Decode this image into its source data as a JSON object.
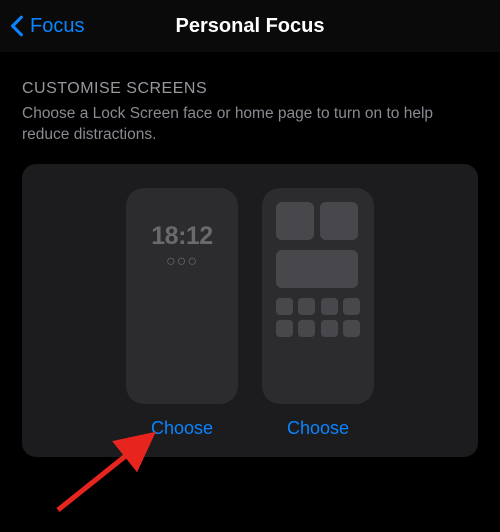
{
  "nav": {
    "back_label": "Focus",
    "title": "Personal Focus"
  },
  "section": {
    "header": "CUSTOMISE SCREENS",
    "description": "Choose a Lock Screen face or home page to turn on to help reduce distractions."
  },
  "screens": {
    "lock": {
      "time": "18:12",
      "dots": "○○○",
      "choose_label": "Choose"
    },
    "home": {
      "choose_label": "Choose"
    }
  }
}
